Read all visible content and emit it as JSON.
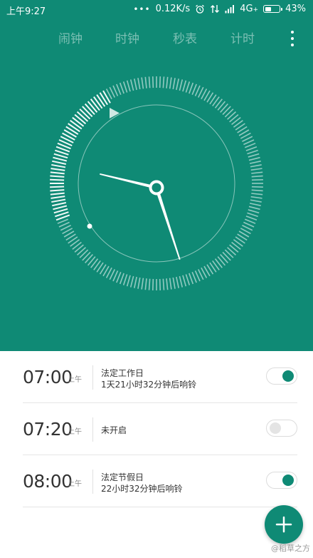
{
  "status_bar": {
    "time": "上午9:27",
    "dots": "•••",
    "net_speed": "0.12K/s",
    "network": "4G",
    "battery_level": "43%",
    "battery_fraction": 0.43
  },
  "tabs": [
    {
      "label": "闹钟",
      "active": true
    },
    {
      "label": "时钟",
      "active": false
    },
    {
      "label": "秒表",
      "active": false
    },
    {
      "label": "计时",
      "active": false
    }
  ],
  "clock": {
    "time": "9:27",
    "hour": 9,
    "minute": 27,
    "colors": {
      "background": "#0f8a75",
      "foreground": "#ffffff"
    }
  },
  "alarms": [
    {
      "time": "07:00",
      "ampm": "上午",
      "line1": "法定工作日",
      "line2": "1天21小时32分钟后响铃",
      "enabled": true
    },
    {
      "time": "07:20",
      "ampm": "上午",
      "line1": "未开启",
      "line2": "",
      "enabled": false
    },
    {
      "time": "08:00",
      "ampm": "上午",
      "line1": "法定节假日",
      "line2": "22小时32分钟后响铃",
      "enabled": true
    }
  ],
  "fab": {
    "icon": "plus-icon"
  },
  "watermark": "@稻草之方",
  "colors": {
    "accent": "#0f8a75"
  }
}
